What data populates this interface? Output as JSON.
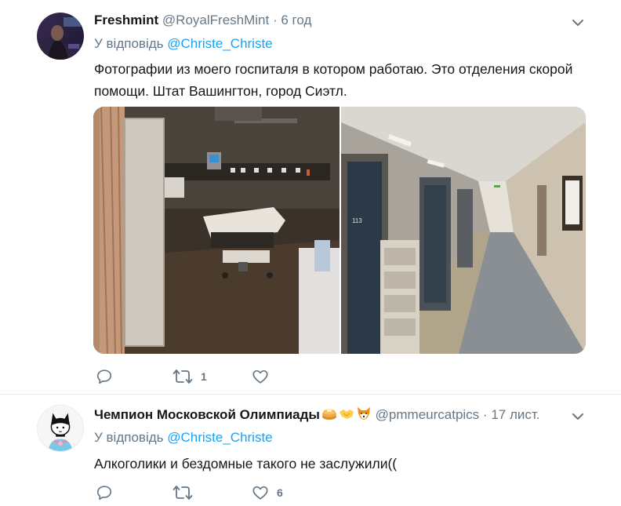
{
  "tweets": [
    {
      "name": "Freshmint",
      "handle": "@RoyalFreshMint",
      "separator": "·",
      "time": "6 год",
      "reply_prefix": "У відповідь",
      "reply_to": "@Christe_Christe",
      "text": "Фотографии из моего госпиталя в котором работаю. Это отделения скорой помощи. Штат Вашингтон, город Сиэтл.",
      "media_left_text": "113",
      "actions": {
        "reply_count": "",
        "retweet_count": "1",
        "like_count": ""
      }
    },
    {
      "name": "Чемпион Московской Олимпиады",
      "name_emojis": [
        "pancake-emoji",
        "handshake-emoji",
        "fox-emoji"
      ],
      "handle": "@pmmeurcatpics",
      "separator": "·",
      "time": "17 лист.",
      "reply_prefix": "У відповідь",
      "reply_to": "@Christe_Christe",
      "text": "Алкоголики и бездомные такого не заслужили((",
      "actions": {
        "reply_count": "",
        "retweet_count": "",
        "like_count": "6"
      }
    }
  ],
  "colors": {
    "link": "#1da1f2",
    "muted": "#657786",
    "text": "#14171a",
    "divider": "#e6ecf0"
  }
}
